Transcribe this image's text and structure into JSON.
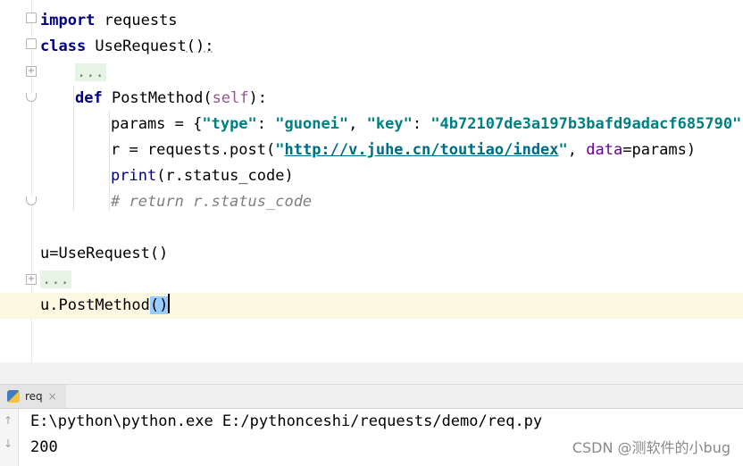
{
  "editor": {
    "lines": {
      "l1": {
        "kw": "import",
        "rest": " requests"
      },
      "l2": {
        "kw": "class",
        "name": " UseRequest",
        "rest": "():"
      },
      "l3": {
        "ellipsis": "..."
      },
      "l4": {
        "kw": "def",
        "name": " PostMethod",
        "open": "(",
        "self": "self",
        "close": "):"
      },
      "l5": {
        "pre": "params = {",
        "s1": "\"type\"",
        "c1": ": ",
        "s2": "\"guonei\"",
        "c2": ", ",
        "s3": "\"key\"",
        "c3": ": ",
        "s4": "\"4b72107de3a197b3bafd9adacf685790\"",
        "end": "}"
      },
      "l6": {
        "pre": "r = requests.post(",
        "q1": "\"",
        "url": "http://v.juhe.cn/toutiao/index",
        "q2": "\"",
        "mid": ", ",
        "param": "data",
        "end": "=params)"
      },
      "l7": {
        "fn": "print",
        "rest": "(r.status_code)"
      },
      "l8": {
        "comment": "# return r.status_code"
      },
      "l9": {
        "text": "u=UseRequest()"
      },
      "l10": {
        "ellipsis": "..."
      },
      "l11": {
        "pre": "u.PostMethod",
        "paren": "()"
      }
    }
  },
  "run_panel": {
    "tab_label": "req",
    "close_glyph": "×",
    "console_lines": [
      "E:\\python\\python.exe E:/pythonceshi/requests/demo/req.py",
      "200"
    ]
  },
  "watermark": "CSDN @测软件的小bug",
  "icons": {
    "fold_expand": "+",
    "fold_collapse": "−",
    "arrow_up": "↑",
    "arrow_down": "↓"
  },
  "colors": {
    "keyword": "#000080",
    "string": "#008080",
    "self": "#94558d",
    "comment": "#808080",
    "current_line": "#fdf8e1"
  }
}
